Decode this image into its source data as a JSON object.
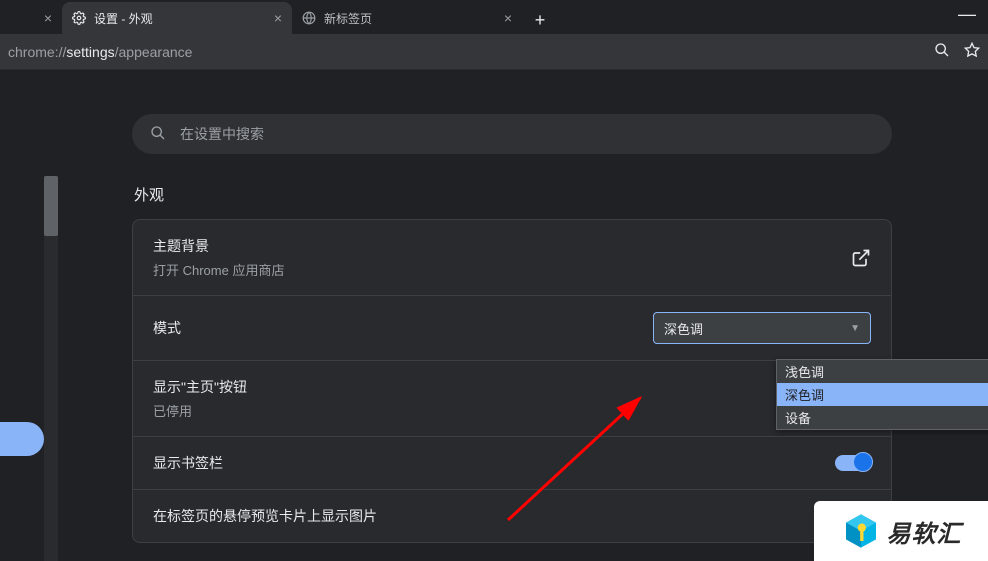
{
  "tabs": {
    "prev_close": "×",
    "active": {
      "title": "设置 - 外观",
      "close": "×"
    },
    "next": {
      "title": "新标签页",
      "close": "×"
    },
    "newtab": "+"
  },
  "window": {
    "minimize": "—"
  },
  "address": {
    "scheme": "chrome://",
    "host": "settings",
    "path": "/appearance"
  },
  "search": {
    "placeholder": "在设置中搜索"
  },
  "section": {
    "title": "外观"
  },
  "rows": {
    "theme": {
      "title": "主题背景",
      "sub": "打开 Chrome 应用商店"
    },
    "mode": {
      "title": "模式",
      "selected": "深色调",
      "options": [
        "浅色调",
        "深色调",
        "设备"
      ],
      "selected_index": 1
    },
    "home": {
      "title": "显示\"主页\"按钮",
      "sub": "已停用"
    },
    "bookmarks": {
      "title": "显示书签栏",
      "toggle_on": true
    },
    "hover": {
      "title": "在标签页的悬停预览卡片上显示图片"
    }
  },
  "watermark": {
    "text": "易软汇"
  }
}
